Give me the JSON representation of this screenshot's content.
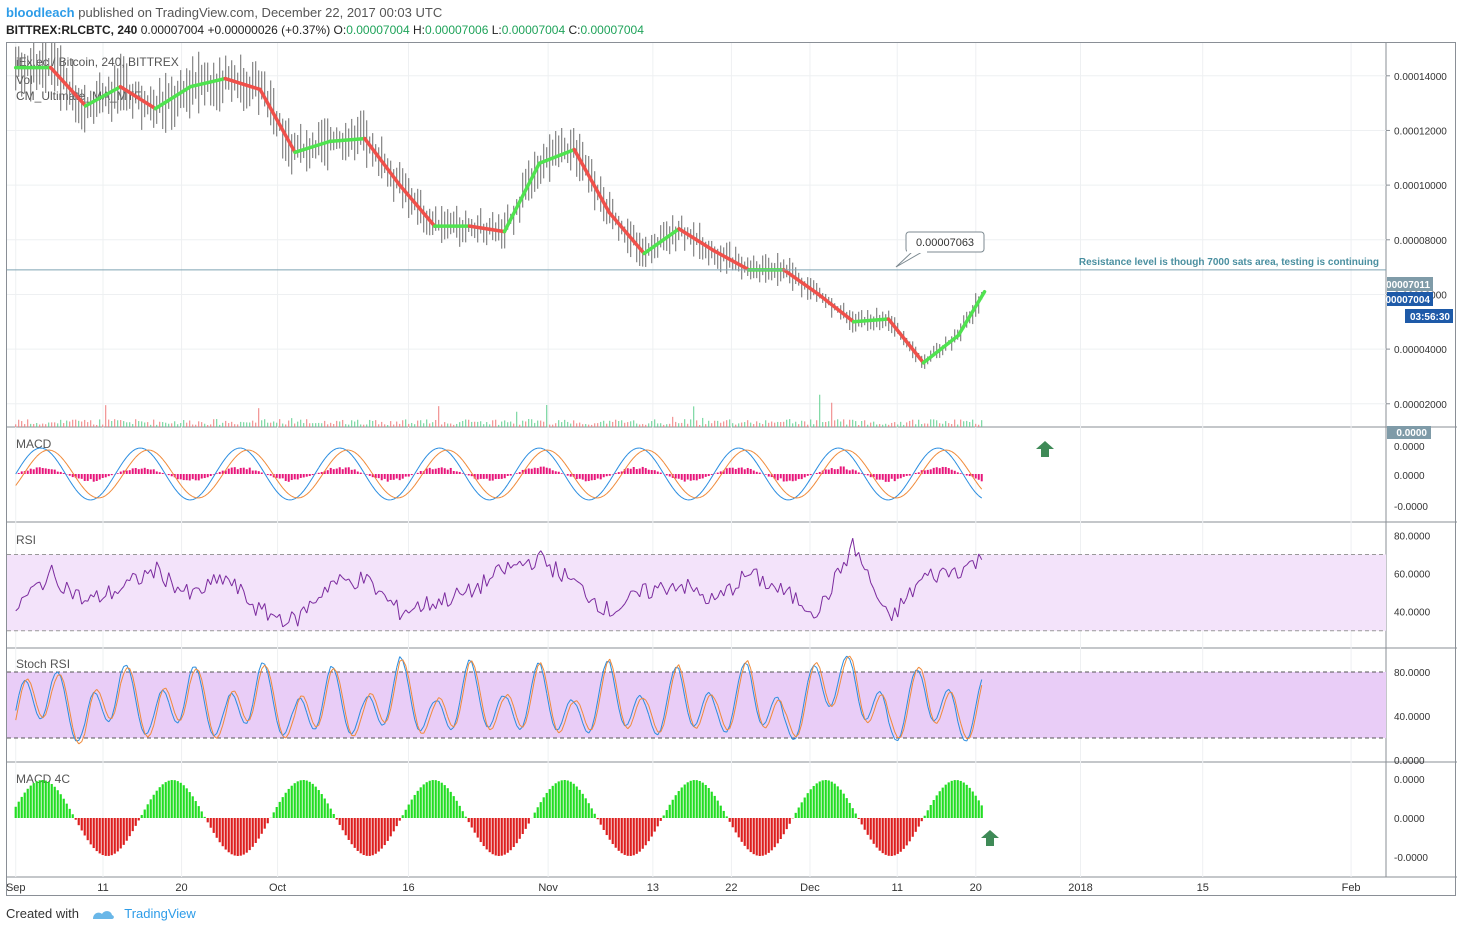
{
  "header": {
    "user": "bloodleach",
    "published": " published on TradingView.com, December 22, 2017 00:03 UTC",
    "symbol": "BITTREX:RLCBTC, 240",
    "last": "0.00007004",
    "change": "+0.00000026 (+0.37%)",
    "o_label": "O:",
    "o_value": "0.00007004",
    "h_label": "H:",
    "h_value": "0.00007006",
    "l_label": "L:",
    "l_value": "0.00007004",
    "c_label": "C:",
    "c_value": "0.00007004"
  },
  "main_pane": {
    "legend": [
      "iEx.ec / Bitcoin, 240, BITTREX",
      "Vol",
      "CM_Ultimate_MA_MTF"
    ],
    "annotation_price": "0.00007063",
    "annotation_note": "Resistance level is though 7000 sats area, testing is continuing",
    "price_badge_1": "0.00007011",
    "price_badge_2": "0.00007004",
    "countdown": "03:56:30"
  },
  "panes": {
    "macd_label": "MACD",
    "macd_badge": "0.0000",
    "rsi_label": "RSI",
    "stoch_label": "Stoch RSI",
    "macd4c_label": "MACD 4C"
  },
  "footer": {
    "created_with": "Created with",
    "brand": "TradingView"
  },
  "colors": {
    "ma_up": "#4fe34f",
    "ma_down": "#f0504a",
    "candle": "#6b6b6b",
    "macd_hist": "#e8157a",
    "macd_line": "#2a8de0",
    "signal_line": "#f08a3a",
    "rsi_line": "#7b2a9e",
    "rsi_band": "#f3e3fa",
    "stoch_band": "#e9cdf7",
    "macd4c_up": "#22dd22",
    "macd4c_down": "#dd1e1e",
    "arrow": "#3f8a57",
    "badge_blue": "#1e5aa8",
    "badge_grey": "#7f9ba8"
  },
  "chart_data": [
    {
      "type": "line",
      "title": "iEx.ec / Bitcoin, 240, BITTREX",
      "series": [
        {
          "name": "CM_Ultimate_MA_MTF",
          "x": [
            "2017-09-01",
            "2017-09-05",
            "2017-09-09",
            "2017-09-13",
            "2017-09-17",
            "2017-09-21",
            "2017-09-25",
            "2017-09-29",
            "2017-10-03",
            "2017-10-07",
            "2017-10-11",
            "2017-10-15",
            "2017-10-19",
            "2017-10-23",
            "2017-10-27",
            "2017-10-31",
            "2017-11-04",
            "2017-11-08",
            "2017-11-12",
            "2017-11-16",
            "2017-11-20",
            "2017-11-24",
            "2017-11-28",
            "2017-12-02",
            "2017-12-06",
            "2017-12-10",
            "2017-12-14",
            "2017-12-18",
            "2017-12-21"
          ],
          "values": [
            0.000143,
            0.000143,
            0.000129,
            0.000136,
            0.000128,
            0.000136,
            0.000139,
            0.000135,
            0.000112,
            0.000116,
            0.000117,
            0.0001,
            8.5e-05,
            8.5e-05,
            8.3e-05,
            0.000108,
            0.000113,
            9e-05,
            7.5e-05,
            8.4e-05,
            7.6e-05,
            6.9e-05,
            6.9e-05,
            6e-05,
            5e-05,
            5.1e-05,
            3.5e-05,
            4.5e-05,
            6.1e-05
          ]
        }
      ],
      "horizontal_line": 6.9e-05,
      "ylim": [
        1.15e-05,
        0.000152
      ],
      "y_ticks": [
        "0.00014000",
        "0.00012000",
        "0.00010000",
        "0.00008000",
        "0.00006000",
        "0.00004000",
        "0.00002000"
      ],
      "x_ticks": [
        "Sep",
        "11",
        "20",
        "Oct",
        "16",
        "Nov",
        "13",
        "22",
        "Dec",
        "11",
        "20",
        "2018",
        "15",
        "Feb"
      ],
      "x_tick_dates": [
        "2017-09-01",
        "2017-09-11",
        "2017-09-20",
        "2017-10-01",
        "2017-10-16",
        "2017-11-01",
        "2017-11-13",
        "2017-11-22",
        "2017-12-01",
        "2017-12-11",
        "2017-12-20",
        "2018-01-01",
        "2018-01-15",
        "2018-02-01"
      ],
      "xlim": [
        "2017-08-31",
        "2018-02-05"
      ],
      "grid": true
    },
    {
      "type": "line",
      "title": "RSI",
      "series": [
        {
          "x": [
            "2017-09-01",
            "2017-09-05",
            "2017-09-09",
            "2017-09-13",
            "2017-09-17",
            "2017-09-21",
            "2017-09-25",
            "2017-09-29",
            "2017-10-03",
            "2017-10-07",
            "2017-10-11",
            "2017-10-15",
            "2017-10-19",
            "2017-10-23",
            "2017-10-27",
            "2017-10-31",
            "2017-11-04",
            "2017-11-08",
            "2017-11-12",
            "2017-11-16",
            "2017-11-20",
            "2017-11-24",
            "2017-11-28",
            "2017-12-02",
            "2017-12-06",
            "2017-12-10",
            "2017-12-14",
            "2017-12-18",
            "2017-12-21"
          ],
          "values": [
            42,
            60,
            45,
            52,
            62,
            48,
            58,
            40,
            35,
            55,
            57,
            40,
            45,
            50,
            62,
            68,
            55,
            40,
            50,
            55,
            45,
            60,
            50,
            40,
            75,
            35,
            58,
            62,
            68
          ]
        }
      ],
      "bands": [
        30,
        70
      ],
      "y_ticks": [
        "80.0000",
        "60.0000",
        "40.0000"
      ],
      "ylim": [
        22,
        86
      ]
    },
    {
      "type": "line",
      "title": "Stoch RSI",
      "series": [
        {
          "x": [
            "2017-09-01",
            "2017-09-05",
            "2017-09-09",
            "2017-09-13",
            "2017-09-17",
            "2017-09-21",
            "2017-09-25",
            "2017-09-29",
            "2017-10-03",
            "2017-10-07",
            "2017-10-11",
            "2017-10-15",
            "2017-10-19",
            "2017-10-23",
            "2017-10-27",
            "2017-10-31",
            "2017-11-04",
            "2017-11-08",
            "2017-11-12",
            "2017-11-16",
            "2017-11-20",
            "2017-11-24",
            "2017-11-28",
            "2017-12-02",
            "2017-12-06",
            "2017-12-10",
            "2017-12-14",
            "2017-12-18",
            "2017-12-21"
          ],
          "values": [
            40,
            80,
            10,
            90,
            20,
            85,
            15,
            90,
            10,
            80,
            15,
            95,
            10,
            90,
            20,
            85,
            10,
            90,
            15,
            80,
            20,
            90,
            5,
            90,
            95,
            10,
            85,
            15,
            60
          ]
        }
      ],
      "bands": [
        20,
        80
      ],
      "y_ticks": [
        "80.0000",
        "40.0000",
        "0.0000"
      ],
      "ylim": [
        0,
        100
      ]
    }
  ]
}
